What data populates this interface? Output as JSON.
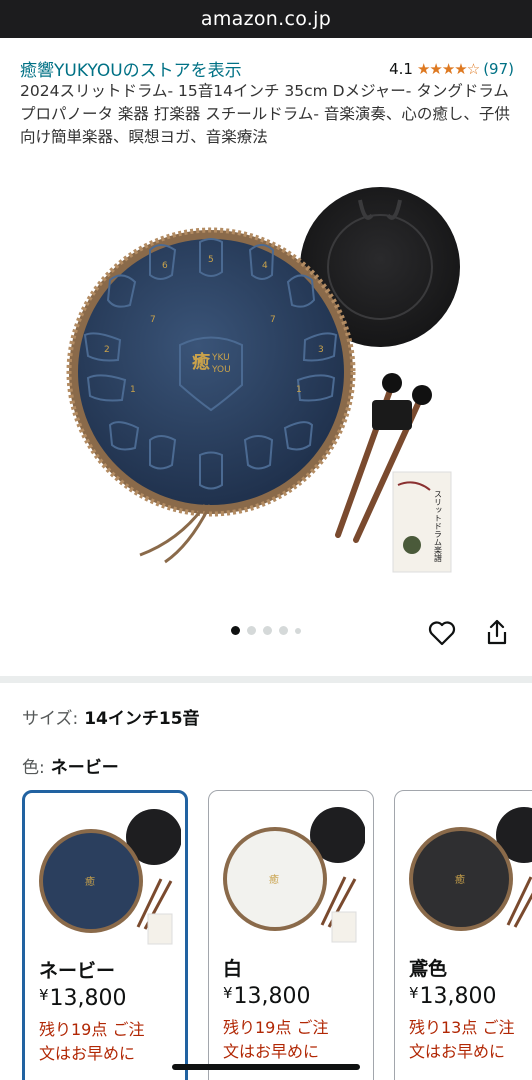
{
  "browser": {
    "url": "amazon.co.jp"
  },
  "product": {
    "store_link": "癒響YUKYOUのストアを表示",
    "rating": {
      "score": "4.1",
      "stars": 4,
      "count": "(97)"
    },
    "title": "2024スリットドラム- 15音14インチ 35cm Dメジャー- タングドラム プロパノータ 楽器 打楽器 スチールドラム- 音楽演奏、心の癒し、子供向け簡単楽器、瞑想ヨガ、音楽療法"
  },
  "gallery": {
    "image_count": 5,
    "active_index": 0,
    "drum_logo": "YKUYOU",
    "book_title": "スリットドラム楽譜",
    "icons": [
      "heart-icon",
      "share-icon"
    ]
  },
  "options": {
    "size": {
      "label": "サイズ:",
      "value": "14インチ15音"
    },
    "color": {
      "label": "色:",
      "value": "ネービー"
    },
    "variants": [
      {
        "name": "ネービー",
        "currency": "¥",
        "price": "13,800",
        "stock_line1": "残り19点 ご注",
        "stock_line2": "文はお早めに",
        "drum_color": "#2b3f5e",
        "selected": true
      },
      {
        "name": "白",
        "currency": "¥",
        "price": "13,800",
        "stock_line1": "残り19点 ご注",
        "stock_line2": "文はお早めに",
        "drum_color": "#f2f2ee",
        "selected": false
      },
      {
        "name": "鳶色",
        "currency": "¥",
        "price": "13,800",
        "stock_line1": "残り13点 ご注",
        "stock_line2": "文はお早めに",
        "drum_color": "#2f2f31",
        "selected": false
      }
    ]
  },
  "colors": {
    "link": "#007185",
    "star": "#de7921",
    "stock_red": "#b12704",
    "selected_border": "#2162a1"
  }
}
